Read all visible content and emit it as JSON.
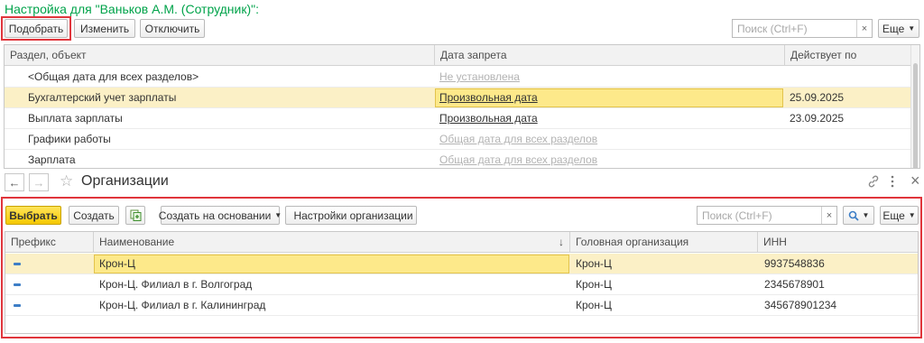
{
  "top_form": {
    "title": "Настройка для \"Ваньков А.М. (Сотрудник)\":",
    "toolbar": {
      "pick_label": "Подобрать",
      "edit_label": "Изменить",
      "disable_label": "Отключить",
      "search_placeholder": "Поиск (Ctrl+F)",
      "clear_glyph": "×",
      "more_label": "Еще"
    },
    "columns": [
      "Раздел, объект",
      "Дата запрета",
      "Действует по"
    ],
    "rows": [
      {
        "section": "<Общая дата для всех разделов>",
        "date": "Не установлена",
        "date_style": "muted",
        "valid_to": ""
      },
      {
        "section": "Бухгалтерский учет зарплаты",
        "date": "Произвольная дата",
        "date_style": "link",
        "valid_to": "25.09.2025",
        "selected": true
      },
      {
        "section": "Выплата зарплаты",
        "date": "Произвольная дата",
        "date_style": "link",
        "valid_to": "23.09.2025"
      },
      {
        "section": "Графики работы",
        "date": "Общая дата для всех разделов",
        "date_style": "muted",
        "valid_to": ""
      },
      {
        "section": "Зарплата",
        "date": "Общая дата для всех разделов",
        "date_style": "muted",
        "valid_to": ""
      }
    ]
  },
  "window": {
    "back_glyph": "←",
    "forward_glyph": "→",
    "star_glyph": "☆",
    "title": "Организации",
    "link_icon": "link-icon",
    "menu_icon": "more-vertical-icon",
    "close_glyph": "×"
  },
  "org_toolbar": {
    "select_label": "Выбрать",
    "create_label": "Создать",
    "create_based_label": "Создать на основании",
    "settings_label": "Настройки организации",
    "search_placeholder": "Поиск (Ctrl+F)",
    "clear_glyph": "×",
    "more_label": "Еще"
  },
  "org_table": {
    "columns": [
      "Префикс",
      "Наименование",
      "Головная организация",
      "ИНН"
    ],
    "sort_glyph": "↓",
    "rows": [
      {
        "prefix": "",
        "name": "Крон-Ц",
        "head": "Крон-Ц",
        "inn": "9937548836",
        "selected": true
      },
      {
        "prefix": "",
        "name": "Крон-Ц. Филиал в г. Волгоград",
        "head": "Крон-Ц",
        "inn": "2345678901"
      },
      {
        "prefix": "",
        "name": "Крон-Ц. Филиал в г. Калининград",
        "head": "Крон-Ц",
        "inn": "345678901234"
      }
    ]
  },
  "colors": {
    "title_green": "#00a34a",
    "highlight_red": "#e0353c",
    "select_yellow": "#f5c800",
    "selected_row": "#fbf0c6"
  }
}
